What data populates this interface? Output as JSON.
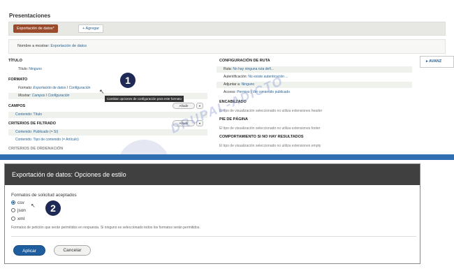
{
  "top": {
    "page_title": "Presentaciones",
    "tabs": {
      "active": "Exportación de datos*",
      "add": "Agregar"
    },
    "display_name": {
      "label": "Nombre a mostrar:",
      "value": "Exportación de datos"
    },
    "left": {
      "titulo": {
        "heading": "TÍTULO",
        "row_label": "Título:",
        "row_value": "Ninguno"
      },
      "formato": {
        "heading": "FORMATO",
        "formato_label": "Formato:",
        "formato_value": "Exportación de datos",
        "sep1": "/",
        "formato_settings": "Configuración",
        "mostrar_label": "Mostrar:",
        "mostrar_value": "Campos",
        "sep2": "/",
        "mostrar_settings": "Configuración"
      },
      "campos": {
        "heading": "CAMPOS",
        "add": "Añadir",
        "item": "Contenido: Título"
      },
      "filtros": {
        "heading": "CRITERIOS DE FILTRADO",
        "add": "Añadir",
        "items": [
          "Contenido: Publicado (= Sí)",
          "Contenido: Tipo de contenido (= Artículo)"
        ]
      },
      "orden_heading": "CRITERIOS DE ORDENACIÓN"
    },
    "middle": {
      "ruta": {
        "heading": "CONFIGURACIÓN DE RUTA",
        "rows": [
          {
            "label": "Ruta:",
            "value": "No hay ninguna ruta defi..."
          },
          {
            "label": "Autentificación:",
            "value": "No existe autenticación ..."
          },
          {
            "label": "Adjuntar a:",
            "value": "Ninguno"
          },
          {
            "label": "Acceso:",
            "value": "Permiso",
            "sep": "|",
            "extra": "Ver contenido publicado"
          }
        ]
      },
      "encabezado": {
        "heading": "ENCABEZADO",
        "text": "El tipo de visualización seleccionado no utiliza extensiones header"
      },
      "pie": {
        "heading": "PIE DE PÁGINA",
        "text": "El tipo de visualización seleccionado no utiliza extensiones footer"
      },
      "sin_resultados": {
        "heading": "COMPORTAMIENTO SI NO HAY RESULTADOS",
        "text": "El tipo de visualización seleccionado no utiliza extensiones empty"
      }
    },
    "advanced": "AVANZ",
    "tooltip": "Cambiar opciones de configuración para este formato",
    "badge": "1",
    "watermark": "DRUPAL-ADICTO",
    "caret": "▾",
    "cursor": "↖"
  },
  "dialog": {
    "title": "Exportación de datos: Opciones de estilo",
    "legend": "Formatos de solicitud aceptados",
    "options": [
      {
        "label": "csv",
        "checked": true
      },
      {
        "label": "json",
        "checked": false
      },
      {
        "label": "xml",
        "checked": false
      }
    ],
    "hint": "Formatos de petición que serán permitidos en respuesta. Si ninguno es seleccionado todos los formatos serán permitidos.",
    "apply": "Aplicar",
    "cancel": "Cancelar",
    "badge": "2"
  },
  "colors": {
    "accent": "#9a4b2b",
    "link": "#2a6496",
    "primary_button": "#1f5e9e",
    "divider": "#2f6fb2",
    "badge": "#1e2a55"
  }
}
